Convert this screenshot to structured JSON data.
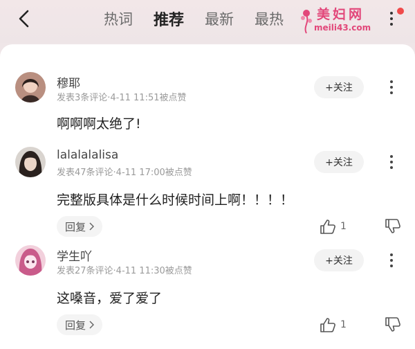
{
  "header": {
    "tabs": [
      {
        "label": "热词"
      },
      {
        "label": "推荐"
      },
      {
        "label": "最新"
      },
      {
        "label": "最热"
      }
    ],
    "active_tab": "推荐",
    "watermark_title": "美妇网",
    "watermark_url": "meili43.com",
    "notification_color": "#f04a4a"
  },
  "comments": [
    {
      "user": "穆耶",
      "meta": "发表3条评论·4-11 11:51被点赞",
      "follow_label": "+关注",
      "text": "啊啊啊太绝了!"
    },
    {
      "user": "lalalalalisa",
      "meta": "发表47条评论·4-11 17:00被点赞",
      "follow_label": "+关注",
      "text": "完整版具体是什么时候时间上啊！！！！",
      "reply_label": "回复",
      "like_count": "1"
    },
    {
      "user": "学生吖",
      "meta": "发表27条评论·4-11 11:30被点赞",
      "follow_label": "+关注",
      "text": "这嗓音，爱了爱了",
      "reply_label": "回复",
      "like_count": "1"
    }
  ],
  "icons": {
    "back": "chevron-left-icon",
    "more": "more-vertical-icon",
    "like": "thumbs-up-icon",
    "dislike": "thumbs-down-icon"
  }
}
